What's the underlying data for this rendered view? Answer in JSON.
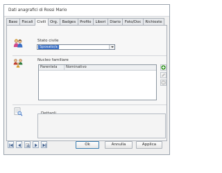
{
  "window": {
    "title": "Dati anagrafici di Rossi Mario"
  },
  "tabs": [
    {
      "label": "Base",
      "active": false
    },
    {
      "label": "Fiscali",
      "active": false
    },
    {
      "label": "Civili",
      "active": true
    },
    {
      "label": "Org.",
      "active": false
    },
    {
      "label": "Badges",
      "active": false
    },
    {
      "label": "Profilo",
      "active": false
    },
    {
      "label": "Liberi",
      "active": false
    },
    {
      "label": "Diario",
      "active": false
    },
    {
      "label": "Foto/Doc",
      "active": false
    },
    {
      "label": "Richieste",
      "active": false
    }
  ],
  "stato_civile": {
    "label": "Stato civile",
    "value": "Sposato/a"
  },
  "nucleo": {
    "label": "Nucleo familiare",
    "columns": [
      "Parentela",
      "Nominativo"
    ],
    "rows": []
  },
  "dettagli": {
    "label": "Dettagli"
  },
  "buttons": {
    "ok": "Ok",
    "cancel": "Annulla",
    "apply": "Applica"
  },
  "colors": {
    "selection": "#3a6fc4",
    "add_green": "#3a9a2a"
  }
}
